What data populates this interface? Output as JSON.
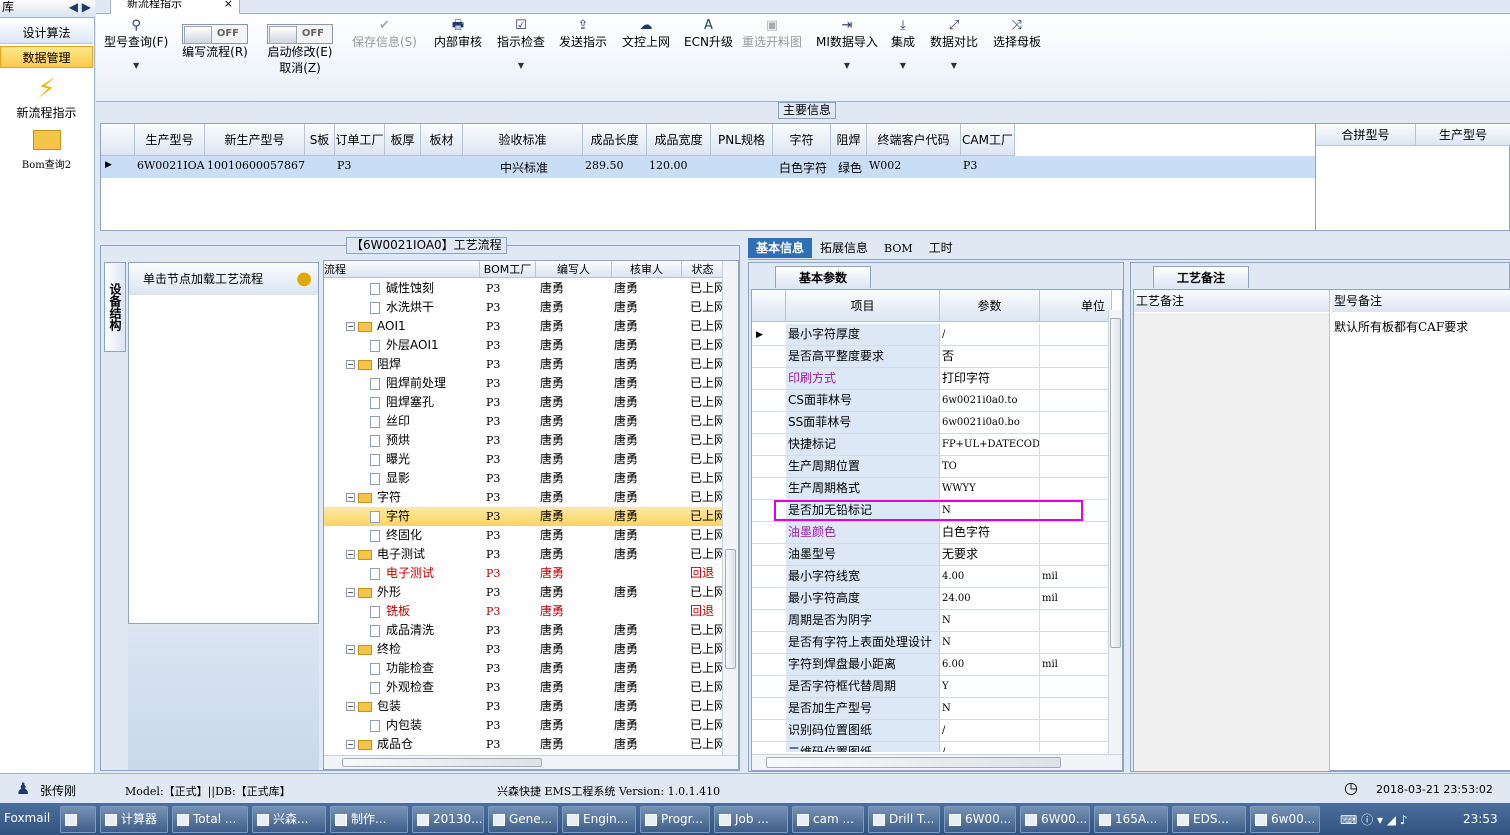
{
  "leftnav": {
    "title": "库",
    "nav1": "设计算法",
    "nav2": "数据管理",
    "icon1": "新流程指示",
    "icon2": "Bom查询2"
  },
  "doc_tab": "新流程指示",
  "toolbar": {
    "query": "型号查询(F)",
    "edit_flow": "编写流程(R)",
    "start_edit": "启动修改(E)",
    "cancel": "取消(Z)",
    "save": "保存信息(S)",
    "review": "内部审核",
    "check": "指示检查",
    "send": "发送指示",
    "upload": "文控上网",
    "ecn": "ECN升级",
    "reselect": "重选开料图",
    "mi_import": "MI数据导入",
    "integrate": "集成",
    "compare": "数据对比",
    "template": "选择母板",
    "off": "OFF"
  },
  "main_info": {
    "group": "主要信息",
    "headers": [
      "生产型号",
      "新生产型号",
      "S板",
      "订单工厂",
      "板厚",
      "板材",
      "验收标准",
      "成品长度",
      "成品宽度",
      "PNL规格",
      "字符",
      "阻焊",
      "终端客户代码",
      "CAM工厂"
    ],
    "row": [
      "6W0021IOA0",
      "10010600057867",
      "",
      "P3",
      "",
      "",
      "中兴标准",
      "289.50",
      "120.00",
      "",
      "白色字符",
      "绿色",
      "W002",
      "P3"
    ],
    "right_headers": [
      "合拼型号",
      "生产型号"
    ]
  },
  "flow": {
    "group": "【6W0021IOA0】工艺流程",
    "side_tab": "设备结构",
    "load": "单击节点加载工艺流程",
    "headers": [
      "流程",
      "BOM工厂",
      "编写人",
      "核审人",
      "状态"
    ],
    "rows": [
      {
        "name": "碱性蚀刻",
        "level": 2,
        "bom": "P3",
        "writer": "唐勇",
        "reviewer": "唐勇",
        "status": "已上网"
      },
      {
        "name": "水洗烘干",
        "level": 2,
        "bom": "P3",
        "writer": "唐勇",
        "reviewer": "唐勇",
        "status": "已上网"
      },
      {
        "name": "AOI1",
        "level": 1,
        "bom": "P3",
        "writer": "唐勇",
        "reviewer": "唐勇",
        "status": "已上网"
      },
      {
        "name": "外层AOI1",
        "level": 2,
        "bom": "P3",
        "writer": "唐勇",
        "reviewer": "唐勇",
        "status": "已上网"
      },
      {
        "name": "阻焊",
        "level": 1,
        "bom": "P3",
        "writer": "唐勇",
        "reviewer": "唐勇",
        "status": "已上网"
      },
      {
        "name": "阻焊前处理",
        "level": 2,
        "bom": "P3",
        "writer": "唐勇",
        "reviewer": "唐勇",
        "status": "已上网"
      },
      {
        "name": "阻焊塞孔",
        "level": 2,
        "bom": "P3",
        "writer": "唐勇",
        "reviewer": "唐勇",
        "status": "已上网"
      },
      {
        "name": "丝印",
        "level": 2,
        "bom": "P3",
        "writer": "唐勇",
        "reviewer": "唐勇",
        "status": "已上网"
      },
      {
        "name": "预烘",
        "level": 2,
        "bom": "P3",
        "writer": "唐勇",
        "reviewer": "唐勇",
        "status": "已上网"
      },
      {
        "name": "曝光",
        "level": 2,
        "bom": "P3",
        "writer": "唐勇",
        "reviewer": "唐勇",
        "status": "已上网"
      },
      {
        "name": "显影",
        "level": 2,
        "bom": "P3",
        "writer": "唐勇",
        "reviewer": "唐勇",
        "status": "已上网"
      },
      {
        "name": "字符",
        "level": 1,
        "bom": "P3",
        "writer": "唐勇",
        "reviewer": "唐勇",
        "status": "已上网"
      },
      {
        "name": "字符",
        "level": 2,
        "bom": "P3",
        "writer": "唐勇",
        "reviewer": "唐勇",
        "status": "已上网",
        "selected": true
      },
      {
        "name": "终固化",
        "level": 2,
        "bom": "P3",
        "writer": "唐勇",
        "reviewer": "唐勇",
        "status": "已上网"
      },
      {
        "name": "电子测试",
        "level": 1,
        "bom": "P3",
        "writer": "唐勇",
        "reviewer": "唐勇",
        "status": "已上网"
      },
      {
        "name": "电子测试",
        "level": 2,
        "bom": "P3",
        "writer": "唐勇",
        "reviewer": "",
        "status": "回退",
        "red": true
      },
      {
        "name": "外形",
        "level": 1,
        "bom": "P3",
        "writer": "唐勇",
        "reviewer": "唐勇",
        "status": "已上网"
      },
      {
        "name": "铣板",
        "level": 2,
        "bom": "P3",
        "writer": "唐勇",
        "reviewer": "",
        "status": "回退",
        "red": true
      },
      {
        "name": "成品清洗",
        "level": 2,
        "bom": "P3",
        "writer": "唐勇",
        "reviewer": "唐勇",
        "status": "已上网"
      },
      {
        "name": "终检",
        "level": 1,
        "bom": "P3",
        "writer": "唐勇",
        "reviewer": "唐勇",
        "status": "已上网"
      },
      {
        "name": "功能检查",
        "level": 2,
        "bom": "P3",
        "writer": "唐勇",
        "reviewer": "唐勇",
        "status": "已上网"
      },
      {
        "name": "外观检查",
        "level": 2,
        "bom": "P3",
        "writer": "唐勇",
        "reviewer": "唐勇",
        "status": "已上网"
      },
      {
        "name": "包装",
        "level": 1,
        "bom": "P3",
        "writer": "唐勇",
        "reviewer": "唐勇",
        "status": "已上网"
      },
      {
        "name": "内包装",
        "level": 2,
        "bom": "P3",
        "writer": "唐勇",
        "reviewer": "唐勇",
        "status": "已上网"
      },
      {
        "name": "成品仓",
        "level": 1,
        "bom": "P3",
        "writer": "唐勇",
        "reviewer": "唐勇",
        "status": "已上网"
      }
    ]
  },
  "detail_tabs": [
    "基本信息",
    "拓展信息",
    "BOM",
    "工时"
  ],
  "params": {
    "title": "基本参数",
    "headers": [
      "项目",
      "参数",
      "单位"
    ],
    "rows": [
      {
        "item": "最小字符厚度",
        "value": "/",
        "unit": ""
      },
      {
        "item": "是否高平整度要求",
        "value": "否",
        "unit": ""
      },
      {
        "item": "印刷方式",
        "value": "打印字符",
        "unit": "",
        "purple": true
      },
      {
        "item": "CS面菲林号",
        "value": "6w0021i0a0.to",
        "unit": ""
      },
      {
        "item": "SS面菲林号",
        "value": "6w0021i0a0.bo",
        "unit": ""
      },
      {
        "item": "快捷标记",
        "value": "FP+UL+DATECODE",
        "unit": ""
      },
      {
        "item": "生产周期位置",
        "value": "TO",
        "unit": ""
      },
      {
        "item": "生产周期格式",
        "value": "WWYY",
        "unit": ""
      },
      {
        "item": "是否加无铅标记",
        "value": "N",
        "unit": "",
        "highlight": true
      },
      {
        "item": "油墨颜色",
        "value": "白色字符",
        "unit": "",
        "purple": true
      },
      {
        "item": "油墨型号",
        "value": "无要求",
        "unit": ""
      },
      {
        "item": "最小字符线宽",
        "value": "4.00",
        "unit": "mil"
      },
      {
        "item": "最小字符高度",
        "value": "24.00",
        "unit": "mil"
      },
      {
        "item": "周期是否为阴字",
        "value": "N",
        "unit": ""
      },
      {
        "item": "是否有字符上表面处理设计",
        "value": "N",
        "unit": ""
      },
      {
        "item": "字符到焊盘最小距离",
        "value": "6.00",
        "unit": "mil"
      },
      {
        "item": "是否字符框代替周期",
        "value": "Y",
        "unit": ""
      },
      {
        "item": "是否加生产型号",
        "value": "N",
        "unit": ""
      },
      {
        "item": "识别码位置图纸",
        "value": "/",
        "unit": ""
      },
      {
        "item": "二维码位置图纸",
        "value": "/",
        "unit": ""
      }
    ]
  },
  "remarks": {
    "title": "工艺备注",
    "col1": "工艺备注",
    "col2": "型号备注",
    "note": "默认所有板都有CAF要求"
  },
  "status": {
    "user": "张传刚",
    "model": "Model:【正式】||DB:【正式库】",
    "system": "兴森快捷 EMS工程系统  Version: 1.0.1.410",
    "datetime": "2018-03-21 23:53:02"
  },
  "taskbar": {
    "items": [
      "Foxmail",
      "",
      "计算器",
      "Total ...",
      "兴森...",
      "制作...",
      "20130...",
      "Gene...",
      "Engin...",
      "Progr...",
      "Job ...",
      "cam ...",
      "Drill T...",
      "6W00...",
      "6W00...",
      "165A...",
      "EDS...",
      "6w00..."
    ],
    "time": "23:53"
  },
  "colors": {
    "accent": "#2f6fb5",
    "selected": "#fbd560",
    "highlight": "#e000e0",
    "red": "#c00000",
    "purple": "#9b1d9b"
  }
}
